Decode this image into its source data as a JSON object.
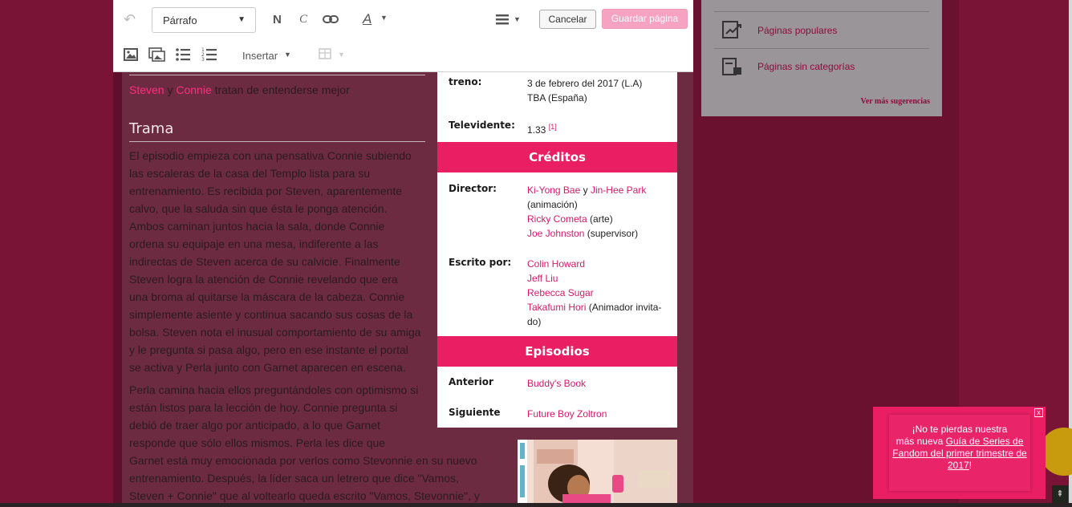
{
  "toolbar": {
    "paragraph_select": "Párrafo",
    "bold_label": "N",
    "italic_label": "C",
    "insert_label": "Insertar",
    "cancel_label": "Cancelar",
    "save_label": "Guardar página"
  },
  "article": {
    "intro_link1": "Steven",
    "intro_y": "y",
    "intro_link2": "Connie",
    "intro_rest": "tratan de entenderse mejor",
    "section_title": "Trama",
    "lines": [
      "El episodio empieza con una pensativa Connie subiendo",
      "las escaleras de la casa del Templo lista para su",
      "entrenamiento. Es recibida por Steven, aparentemente",
      "calvo, que la saluda sin que ésta le ponga atención.",
      "Ambos caminan juntos hacia la sala, donde Connie",
      "ordena su equipaje en una mesa, indiferente a las",
      "indirectas de Steven acerca de su calvicie. Finalmente",
      "Steven logra la atención de Connie revelando que era",
      "una broma al quitarse la máscara de la cabeza. Connie",
      "simplemente asiente y continua sacando sus cosas de la",
      "bolsa. Steven nota el inusual comportamiento de su amiga",
      "y le pregunta si pasa algo, pero en ese instante el portal",
      "se activa y Perla junto con Garnet aparecen en escena."
    ],
    "p2_lines": [
      "Perla camina hacia ellos preguntándoles con optimismo si",
      "están listos para la lección de hoy. Connie pregunta si",
      "debió de traer algo por anticipado, a lo que Garnet",
      "responde que sólo ellos mismos. Perla les dice que",
      "Garnet está muy emocionada por verlos como Stevonnie en su nuevo",
      "entrenamiento. Después, la líder saca un letrero que dice \"Vamos,",
      "Steven + Connie\" que al voltearlo queda escrito \"Vamos, Stevonnie\", y"
    ]
  },
  "infobox": {
    "estreno_label": "treno:",
    "estreno_value_1": "3 de febrero del 2017 (L.A)",
    "estreno_value_2": "TBA (España)",
    "televidentes_label": "Televidente:",
    "televidentes_value": "1.33",
    "televidentes_ref": "[1]",
    "creditos_header": "Créditos",
    "director_label": "Director:",
    "director_1": "Ki-Yong Bae",
    "director_y": "y",
    "director_2": "Jin-Hee Park",
    "director_2_note": "(animación)",
    "director_3": "Ricky Cometa",
    "director_3_note": "(arte)",
    "director_4": "Joe Johnston",
    "director_4_note": "(supervisor)",
    "escrito_label": "Escrito por:",
    "writer_1": "Colin Howard",
    "writer_2": "Jeff Liu",
    "writer_3": "Rebecca Sugar",
    "writer_4": "Takafumi Hori",
    "writer_4_note": "(Animador invita-",
    "writer_4_note2": "do)",
    "episodios_header": "Episodios",
    "anterior_label": "Anterior",
    "anterior_value": "Buddy's Book",
    "siguiente_label": "Siguiente",
    "siguiente_value": "Future Boy Zoltron"
  },
  "rail": {
    "item_popular": "Páginas populares",
    "item_uncategorized": "Páginas sin categorías",
    "more_link": "Ver más sugerencias"
  },
  "notification": {
    "text_1": "¡No te pierdas nuestra",
    "text_2": "más nueva",
    "link": "Guía de Series de Fandom del primer trimestre de 2017",
    "text_end": "!",
    "close": "x"
  },
  "colors": {
    "accent": "#e91e63",
    "link": "#d31c66",
    "overlay_bg": "#6c2b41",
    "save_button": "#f5a3c0"
  }
}
